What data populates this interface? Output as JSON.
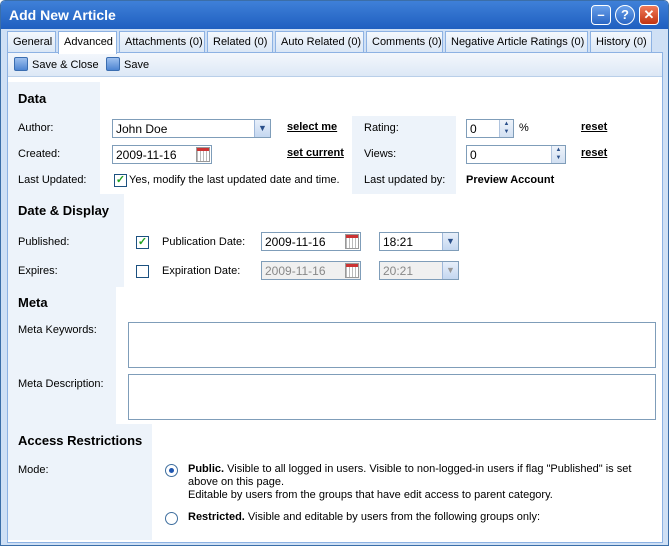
{
  "window": {
    "title": "Add New Article",
    "buttons": {
      "minimize": "–",
      "help": "?",
      "close": "✕"
    }
  },
  "tabs": [
    {
      "label": "General"
    },
    {
      "label": "Advanced"
    },
    {
      "label": "Attachments (0)"
    },
    {
      "label": "Related (0)"
    },
    {
      "label": "Auto Related (0)"
    },
    {
      "label": "Comments (0)"
    },
    {
      "label": "Negative Article Ratings (0)"
    },
    {
      "label": "History (0)"
    }
  ],
  "active_tab": "Advanced",
  "toolbar": {
    "save_close": "Save & Close",
    "save": "Save"
  },
  "data_section": {
    "heading": "Data",
    "author_label": "Author:",
    "author_value": "John Doe",
    "select_me": "select me",
    "rating_label": "Rating:",
    "rating_value": "0",
    "rating_unit": "%",
    "rating_reset": "reset",
    "created_label": "Created:",
    "created_value": "2009-11-16",
    "set_current": "set current",
    "views_label": "Views:",
    "views_value": "0",
    "views_reset": "reset",
    "last_updated_label": "Last Updated:",
    "last_updated_checkbox": "Yes, modify the last updated date and time.",
    "last_updated_by_label": "Last updated by:",
    "last_updated_by_value": "Preview Account"
  },
  "date_section": {
    "heading": "Date & Display",
    "published_label": "Published:",
    "publication_date_label": "Publication Date:",
    "publication_date": "2009-11-16",
    "publication_time": "18:21",
    "expires_label": "Expires:",
    "expiration_date_label": "Expiration Date:",
    "expiration_date": "2009-11-16",
    "expiration_time": "20:21"
  },
  "meta_section": {
    "heading": "Meta",
    "keywords_label": "Meta Keywords:",
    "description_label": "Meta Description:"
  },
  "access_section": {
    "heading": "Access Restrictions",
    "mode_label": "Mode:",
    "public_title": "Public.",
    "public_line1": "Visible to all logged in users. Visible to non-logged-in users if flag \"Published\" is set",
    "public_line2": "above on this page.",
    "public_line3": "Editable by users from the groups that have edit access to parent category.",
    "restricted_title": "Restricted.",
    "restricted_text": "Visible and editable by users from the following groups only:"
  },
  "colors": {
    "title_bar": "#1f5fc0",
    "label_background": "#edf3fa",
    "check_mark": "#21a121"
  }
}
